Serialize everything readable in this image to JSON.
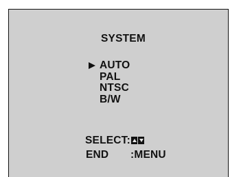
{
  "menu": {
    "title": "SYSTEM",
    "cursor_glyph": "►",
    "options": [
      "AUTO",
      "PAL",
      "NTSC",
      "B/W"
    ],
    "selected": "AUTO"
  },
  "footer": {
    "select_label": "SELECT:",
    "select_icon": "up-down-arrows-icon",
    "end_label": "END",
    "end_value": ":MENU"
  },
  "colors": {
    "screen_bg": "#cfcfcf",
    "text": "#111111"
  }
}
